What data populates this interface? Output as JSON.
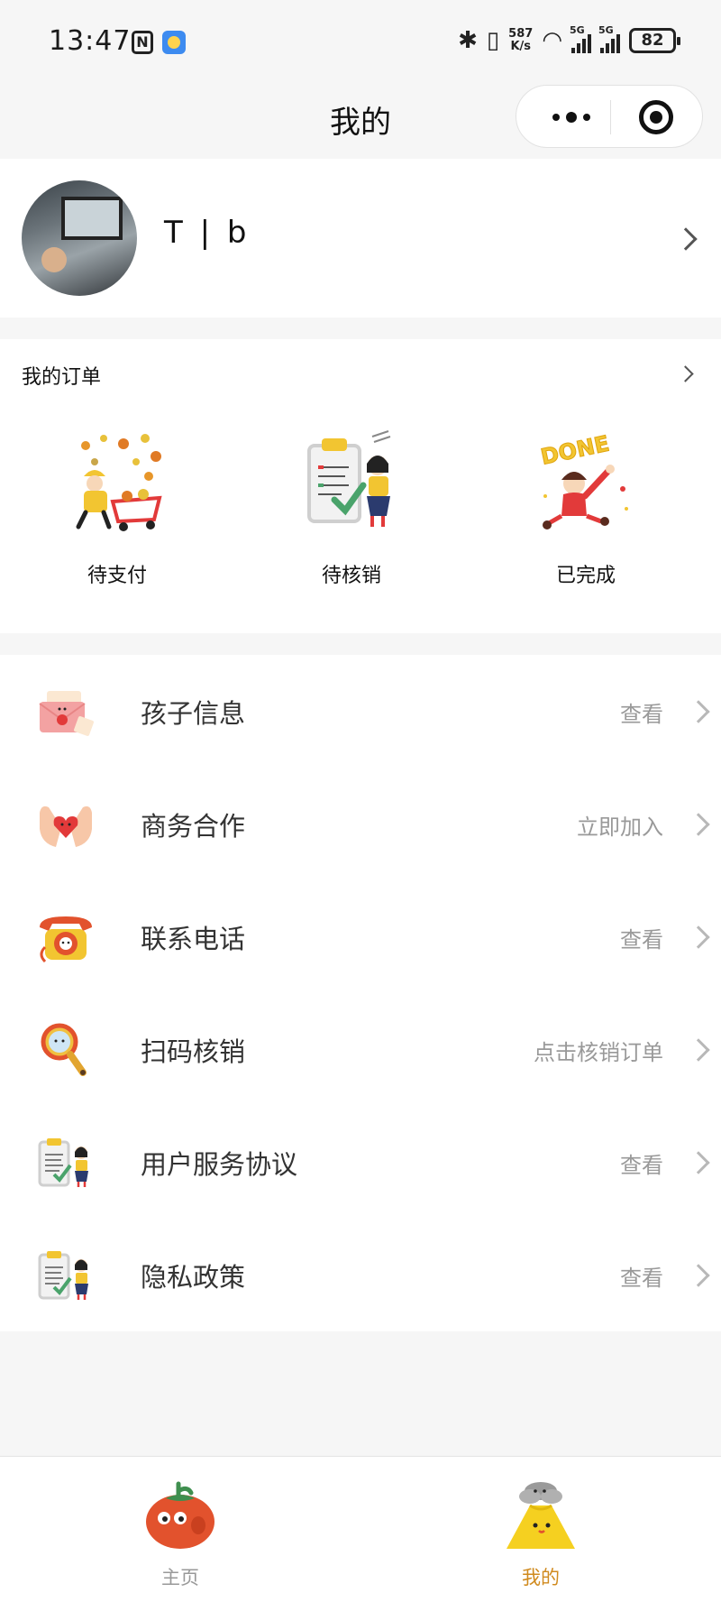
{
  "status_bar": {
    "time": "13:47",
    "nfc": "N",
    "speed_value": "587",
    "speed_unit": "K/s",
    "net1": "5G",
    "net2": "5G",
    "battery": "82"
  },
  "nav": {
    "title": "我的"
  },
  "profile": {
    "nickname": "T | b"
  },
  "orders": {
    "title": "我的订单",
    "items": [
      {
        "label": "待支付",
        "icon": "delivery-cart-icon"
      },
      {
        "label": "待核销",
        "icon": "clipboard-girl-icon"
      },
      {
        "label": "已完成",
        "icon": "done-icon"
      }
    ]
  },
  "menu": {
    "items": [
      {
        "label": "孩子信息",
        "action": "查看",
        "icon": "envelope-icon"
      },
      {
        "label": "商务合作",
        "action": "立即加入",
        "icon": "heart-hands-icon"
      },
      {
        "label": "联系电话",
        "action": "查看",
        "icon": "telephone-icon"
      },
      {
        "label": "扫码核销",
        "action": "点击核销订单",
        "icon": "magnifier-icon"
      },
      {
        "label": "用户服务协议",
        "action": "查看",
        "icon": "clipboard-girl-icon"
      },
      {
        "label": "隐私政策",
        "action": "查看",
        "icon": "clipboard-girl-icon"
      }
    ]
  },
  "tabbar": {
    "items": [
      {
        "label": "主页",
        "active": false,
        "icon": "tomato-icon"
      },
      {
        "label": "我的",
        "active": true,
        "icon": "volcano-icon"
      }
    ],
    "active_color": "#d08a1e",
    "inactive_color": "#999999"
  }
}
